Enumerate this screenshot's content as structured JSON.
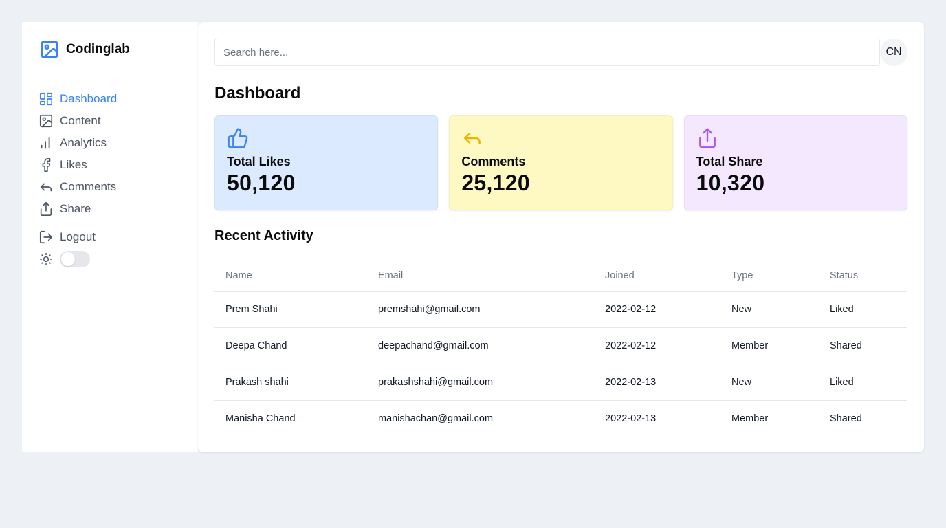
{
  "brand": {
    "name": "Codinglab"
  },
  "sidebar": {
    "items": [
      {
        "label": "Dashboard",
        "icon": "dashboard-icon",
        "active": true
      },
      {
        "label": "Content",
        "icon": "image-icon"
      },
      {
        "label": "Analytics",
        "icon": "bar-chart-icon"
      },
      {
        "label": "Likes",
        "icon": "facebook-icon"
      },
      {
        "label": "Comments",
        "icon": "reply-icon"
      },
      {
        "label": "Share",
        "icon": "share-icon"
      }
    ],
    "logout_label": "Logout",
    "theme_icon": "sun-icon"
  },
  "search": {
    "placeholder": "Search here...",
    "value": ""
  },
  "avatar": {
    "initials": "CN"
  },
  "page_title": "Dashboard",
  "cards": [
    {
      "label": "Total Likes",
      "value": "50,120",
      "icon": "thumbs-up-icon",
      "bg": "#dbeafe",
      "accent": "#3b82f6"
    },
    {
      "label": "Comments",
      "value": "25,120",
      "icon": "reply-icon",
      "bg": "#fef9c3",
      "accent": "#eab308"
    },
    {
      "label": "Total Share",
      "value": "10,320",
      "icon": "share-icon",
      "bg": "#f3e8ff",
      "accent": "#a855f7"
    }
  ],
  "activity": {
    "title": "Recent Activity",
    "columns": [
      "Name",
      "Email",
      "Joined",
      "Type",
      "Status"
    ],
    "rows": [
      [
        "Prem Shahi",
        "premshahi@gmail.com",
        "2022-02-12",
        "New",
        "Liked"
      ],
      [
        "Deepa Chand",
        "deepachand@gmail.com",
        "2022-02-12",
        "Member",
        "Shared"
      ],
      [
        "Prakash shahi",
        "prakashshahi@gmail.com",
        "2022-02-13",
        "New",
        "Liked"
      ],
      [
        "Manisha Chand",
        "manishachan@gmail.com",
        "2022-02-13",
        "Member",
        "Shared"
      ]
    ]
  },
  "colors": {
    "accent": "#3b82f6",
    "background": "#edf1f5"
  }
}
